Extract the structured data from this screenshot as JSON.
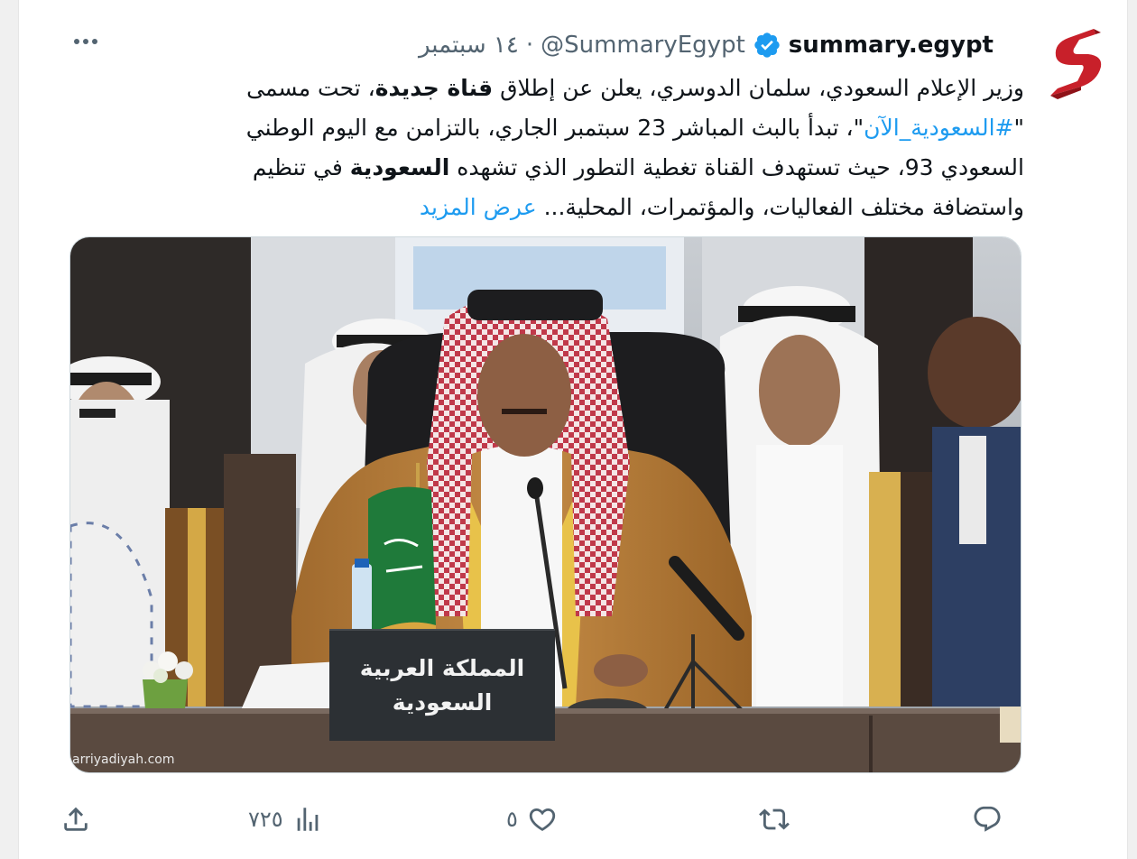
{
  "header": {
    "display_name": "summary.egypt",
    "handle": "@SummaryEgypt",
    "separator": "·",
    "date": "١٤ سبتمبر"
  },
  "tweet": {
    "line1_a": "وزير الإعلام السعودي، سلمان الدوسري، يعلن عن إطلاق ",
    "line1_bold": "قناة جديدة",
    "line1_b": "، تحت مسمى",
    "line2_quote_open": "\"",
    "line2_hashtag": "#السعودية_الآن",
    "line2_rest": "\"، تبدأ بالبث المباشر 23 سبتمبر الجاري، بالتزامن مع اليوم الوطني",
    "line3_a": "السعودي 93، حيث تستهدف القناة تغطية التطور الذي تشهده ",
    "line3_bold": "السعودية",
    "line3_b": " في تنظيم",
    "line4": "واستضافة مختلف الفعاليات، والمؤتمرات، المحلية... ",
    "show_more": "عرض المزيد"
  },
  "media": {
    "nameplate_line1": "المملكة العربية",
    "nameplate_line2": "السعودية",
    "watermark": "arriyadiyah.com"
  },
  "actions": {
    "views": "٧٢٥",
    "likes": "٥"
  },
  "icons": {
    "logo": "summary-egypt-logo",
    "verified": "verified-badge-icon",
    "more": "more-options-icon",
    "share": "share-icon",
    "views": "analytics-icon",
    "like": "heart-icon",
    "retweet": "retweet-icon",
    "reply": "reply-icon"
  },
  "colors": {
    "accent": "#1d9bf0",
    "muted": "#536471",
    "logo_red": "#c8202a"
  }
}
